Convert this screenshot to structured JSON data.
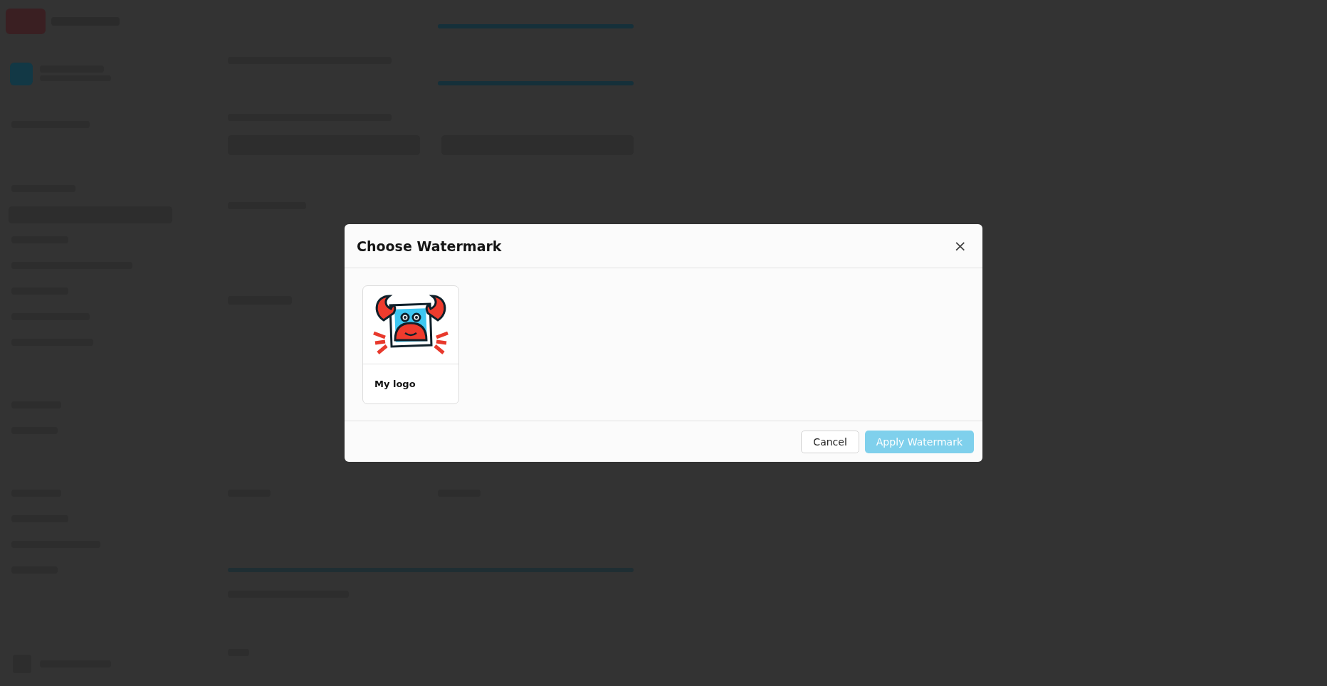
{
  "dialog": {
    "title": "Choose Watermark",
    "close_icon": "×",
    "watermarks": [
      {
        "label": "My logo",
        "selected": false
      }
    ],
    "buttons": [
      {
        "label": "Cancel",
        "kind": "secondary",
        "disabled": false
      },
      {
        "label": "Apply Watermark",
        "kind": "primary",
        "disabled": true
      }
    ]
  }
}
